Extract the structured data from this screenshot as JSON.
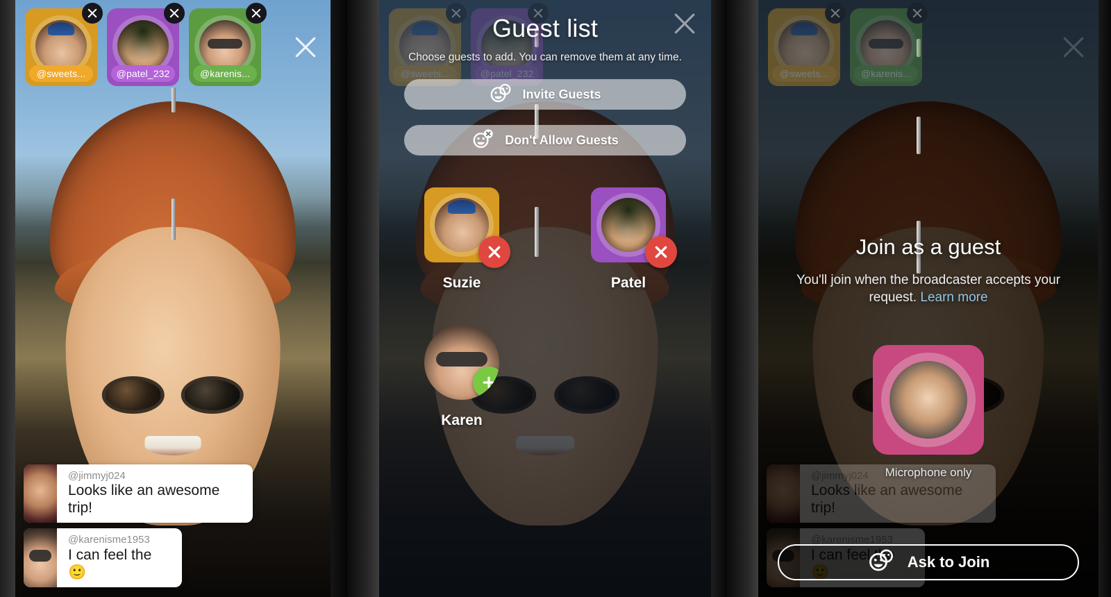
{
  "app": {
    "background_color": "#060709",
    "accent_remove": "#e0473f",
    "accent_add": "#7ac943",
    "link_color": "#8fc6e6"
  },
  "phone1": {
    "name": "live-broadcast-screen",
    "close_icon": "close-x-icon",
    "guests": [
      {
        "handle": "@sweets...",
        "color": "#d79a22",
        "avatar": "suzie-avatar",
        "remove_icon": "remove-guest-icon"
      },
      {
        "handle": "@patel_232",
        "color": "#9a50c0",
        "avatar": "patel-avatar",
        "remove_icon": "remove-guest-icon"
      },
      {
        "handle": "@karenis...",
        "color": "#5a9c3f",
        "avatar": "karen-avatar",
        "remove_icon": "remove-guest-icon"
      }
    ],
    "chat": [
      {
        "username": "@jimmyj024",
        "message": "Looks like an awesome trip!",
        "avatar": "jimmy-avatar"
      },
      {
        "username": "@karenisme1953",
        "message": "I can feel the 🙂",
        "avatar": "karen-chat-avatar"
      }
    ]
  },
  "phone2": {
    "name": "guest-list-sheet",
    "close_icon": "close-x-icon",
    "title": "Guest list",
    "subtitle": "Choose guests to add. You can remove them at any time.",
    "actions": [
      {
        "label": "Invite Guests",
        "icon": "two-faces-icon"
      },
      {
        "label": "Don't Allow Guests",
        "icon": "face-blocked-icon"
      }
    ],
    "guests": [
      {
        "name": "Suzie",
        "color": "#d79a22",
        "avatar": "suzie-avatar",
        "state": "added",
        "action_icon": "remove-x-icon"
      },
      {
        "name": "Patel",
        "color": "#9a50c0",
        "avatar": "patel-avatar",
        "state": "added",
        "action_icon": "remove-x-icon"
      },
      {
        "name": "Karen",
        "color": "transparent",
        "avatar": "karen-avatar",
        "state": "available",
        "action_icon": "add-plus-icon"
      }
    ],
    "background_guests": [
      {
        "handle": "@sweets...",
        "color": "#d79a22",
        "avatar": "suzie-avatar"
      },
      {
        "handle": "@patel_232",
        "color": "#9a50c0",
        "avatar": "patel-avatar"
      }
    ]
  },
  "phone3": {
    "name": "join-as-guest-screen",
    "close_icon": "close-x-icon",
    "title": "Join as a guest",
    "subtitle_text": "You'll join when the broadcaster accepts your request. ",
    "subtitle_link": "Learn more",
    "mic_caption": "Microphone only",
    "mic_avatar": "self-avatar",
    "ask_button": {
      "label": "Ask to Join",
      "icon": "two-faces-icon"
    },
    "guests": [
      {
        "handle": "@sweets...",
        "color": "#d79a22",
        "avatar": "suzie-avatar",
        "remove_icon": "remove-guest-icon"
      },
      {
        "handle": "@karenis...",
        "color": "#5a9c3f",
        "avatar": "karen-avatar",
        "remove_icon": "remove-guest-icon"
      }
    ],
    "chat": [
      {
        "username": "@jimmyj024",
        "message": "Looks like an awesome trip!",
        "avatar": "jimmy-avatar"
      },
      {
        "username": "@karenisme1953",
        "message": "I can feel the 🙂",
        "avatar": "karen-chat-avatar"
      }
    ]
  }
}
